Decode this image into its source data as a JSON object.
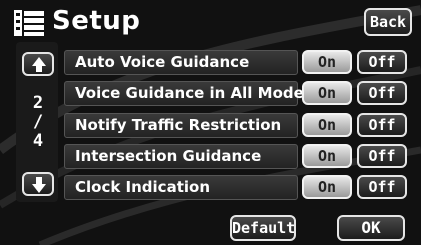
{
  "header": {
    "title": "Setup",
    "back_label": "Back",
    "icon": "list-settings-icon"
  },
  "pager": {
    "up_icon": "scroll-up-icon",
    "down_icon": "scroll-down-icon",
    "current": "2",
    "separator": "/",
    "total": "4"
  },
  "settings": [
    {
      "label": "Auto Voice Guidance",
      "on_label": "On",
      "off_label": "Off",
      "selected": "On"
    },
    {
      "label": "Voice Guidance in All Modes",
      "on_label": "On",
      "off_label": "Off",
      "selected": "On"
    },
    {
      "label": "Notify Traffic Restriction",
      "on_label": "On",
      "off_label": "Off",
      "selected": "On"
    },
    {
      "label": "Intersection Guidance",
      "on_label": "On",
      "off_label": "Off",
      "selected": "On"
    },
    {
      "label": "Clock Indication",
      "on_label": "On",
      "off_label": "Off",
      "selected": "On"
    }
  ],
  "footer": {
    "default_label": "Default",
    "ok_label": "OK"
  }
}
